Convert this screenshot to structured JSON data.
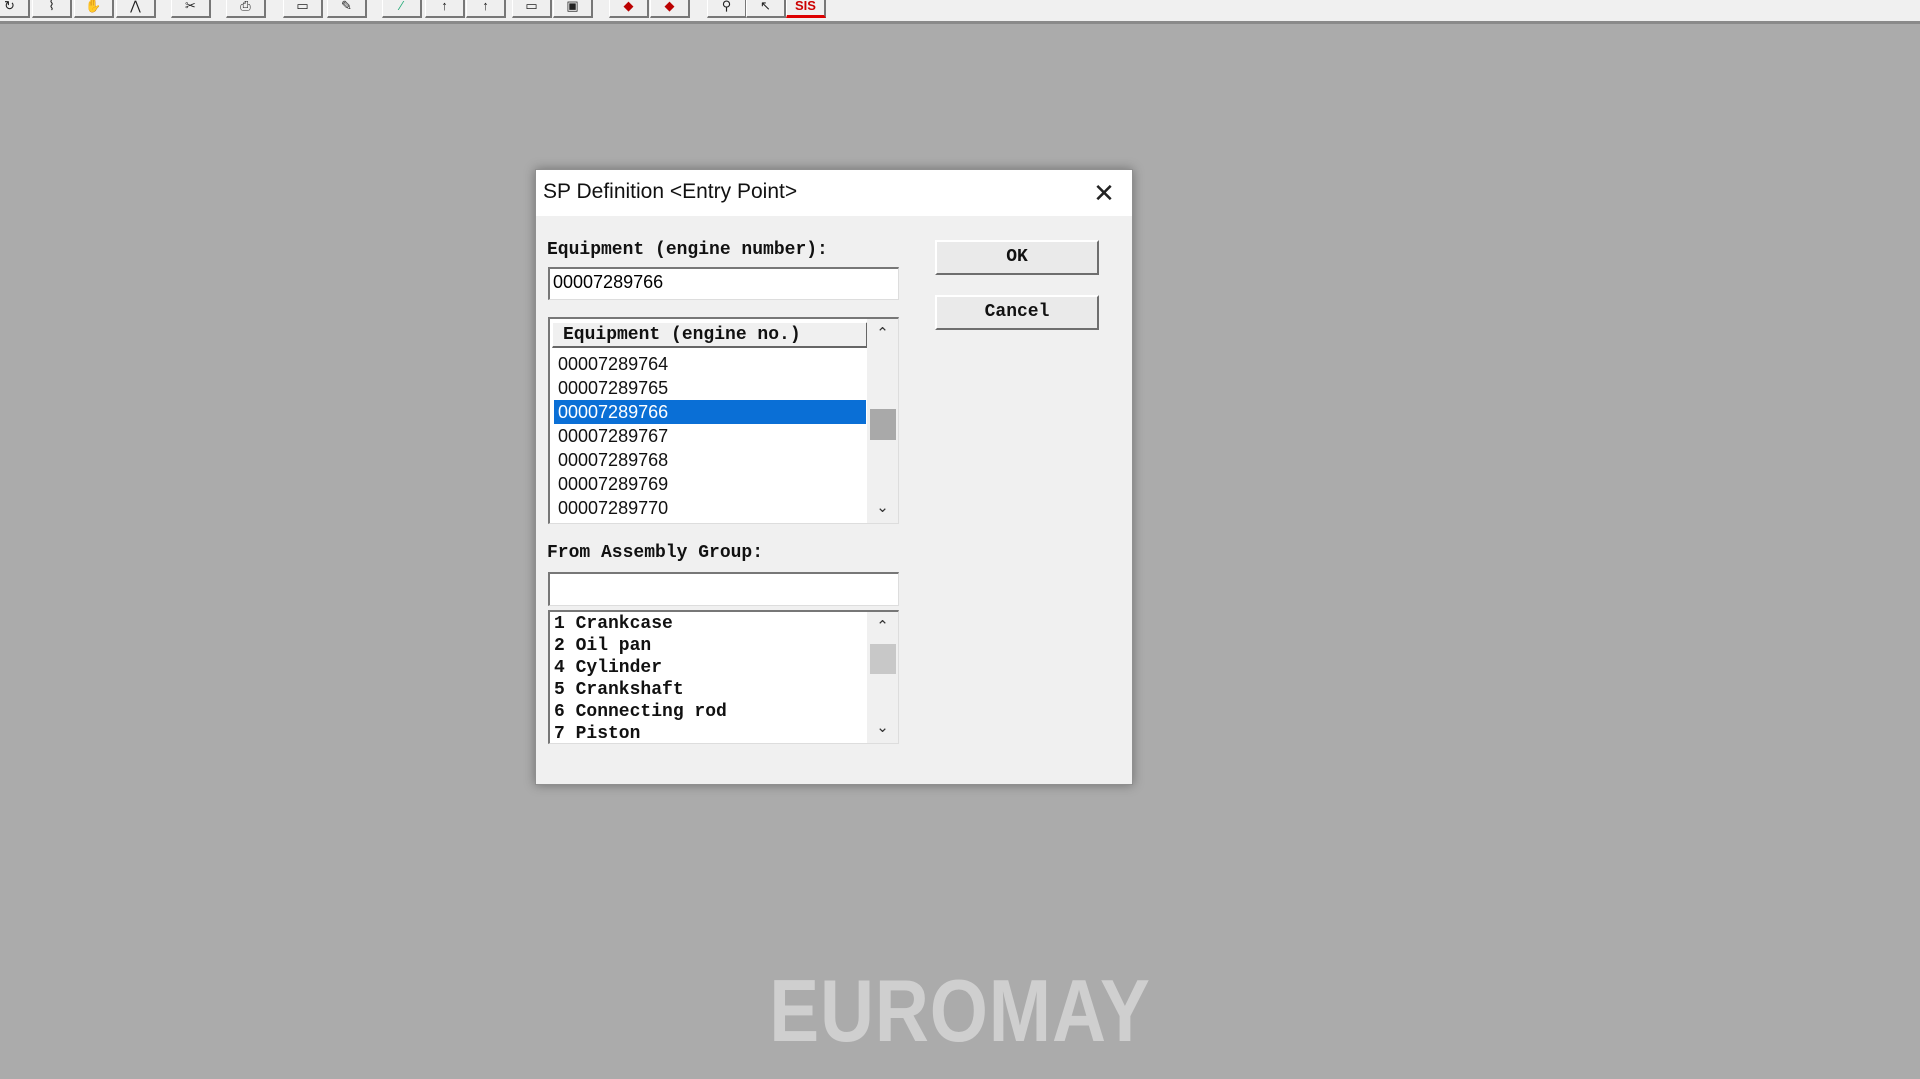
{
  "toolbar": {
    "buttons": [
      "open-icon",
      "pointer-icon",
      "hand-icon",
      "zoom-icon",
      "scissors-icon",
      "print-icon",
      "frame-icon",
      "edit-icon",
      "color-icon",
      "select-icon",
      "select2-icon",
      "window-icon",
      "window2-icon",
      "back-icon",
      "forward-icon",
      "tool-icon",
      "measure-icon",
      "sis-icon"
    ],
    "sis_label": "SIS"
  },
  "dialog": {
    "title": "SP Definition <Entry Point>",
    "close_label": "✕",
    "equipment_label": "Equipment (engine number):",
    "equipment_value": "00007289766",
    "ok_label": "OK",
    "cancel_label": "Cancel",
    "equipment_list": {
      "header": "Equipment (engine no.)",
      "items": [
        "00007289764",
        "00007289765",
        "00007289766",
        "00007289767",
        "00007289768",
        "00007289769",
        "00007289770"
      ],
      "selected_index": 2
    },
    "assembly_label": "From Assembly Group:",
    "assembly_value": "",
    "assembly_list": {
      "items": [
        "1 Crankcase",
        "2 Oil pan",
        "4 Cylinder",
        "5 Crankshaft",
        "6 Connecting rod",
        "7 Piston"
      ]
    }
  },
  "watermark": "EUROMAY"
}
